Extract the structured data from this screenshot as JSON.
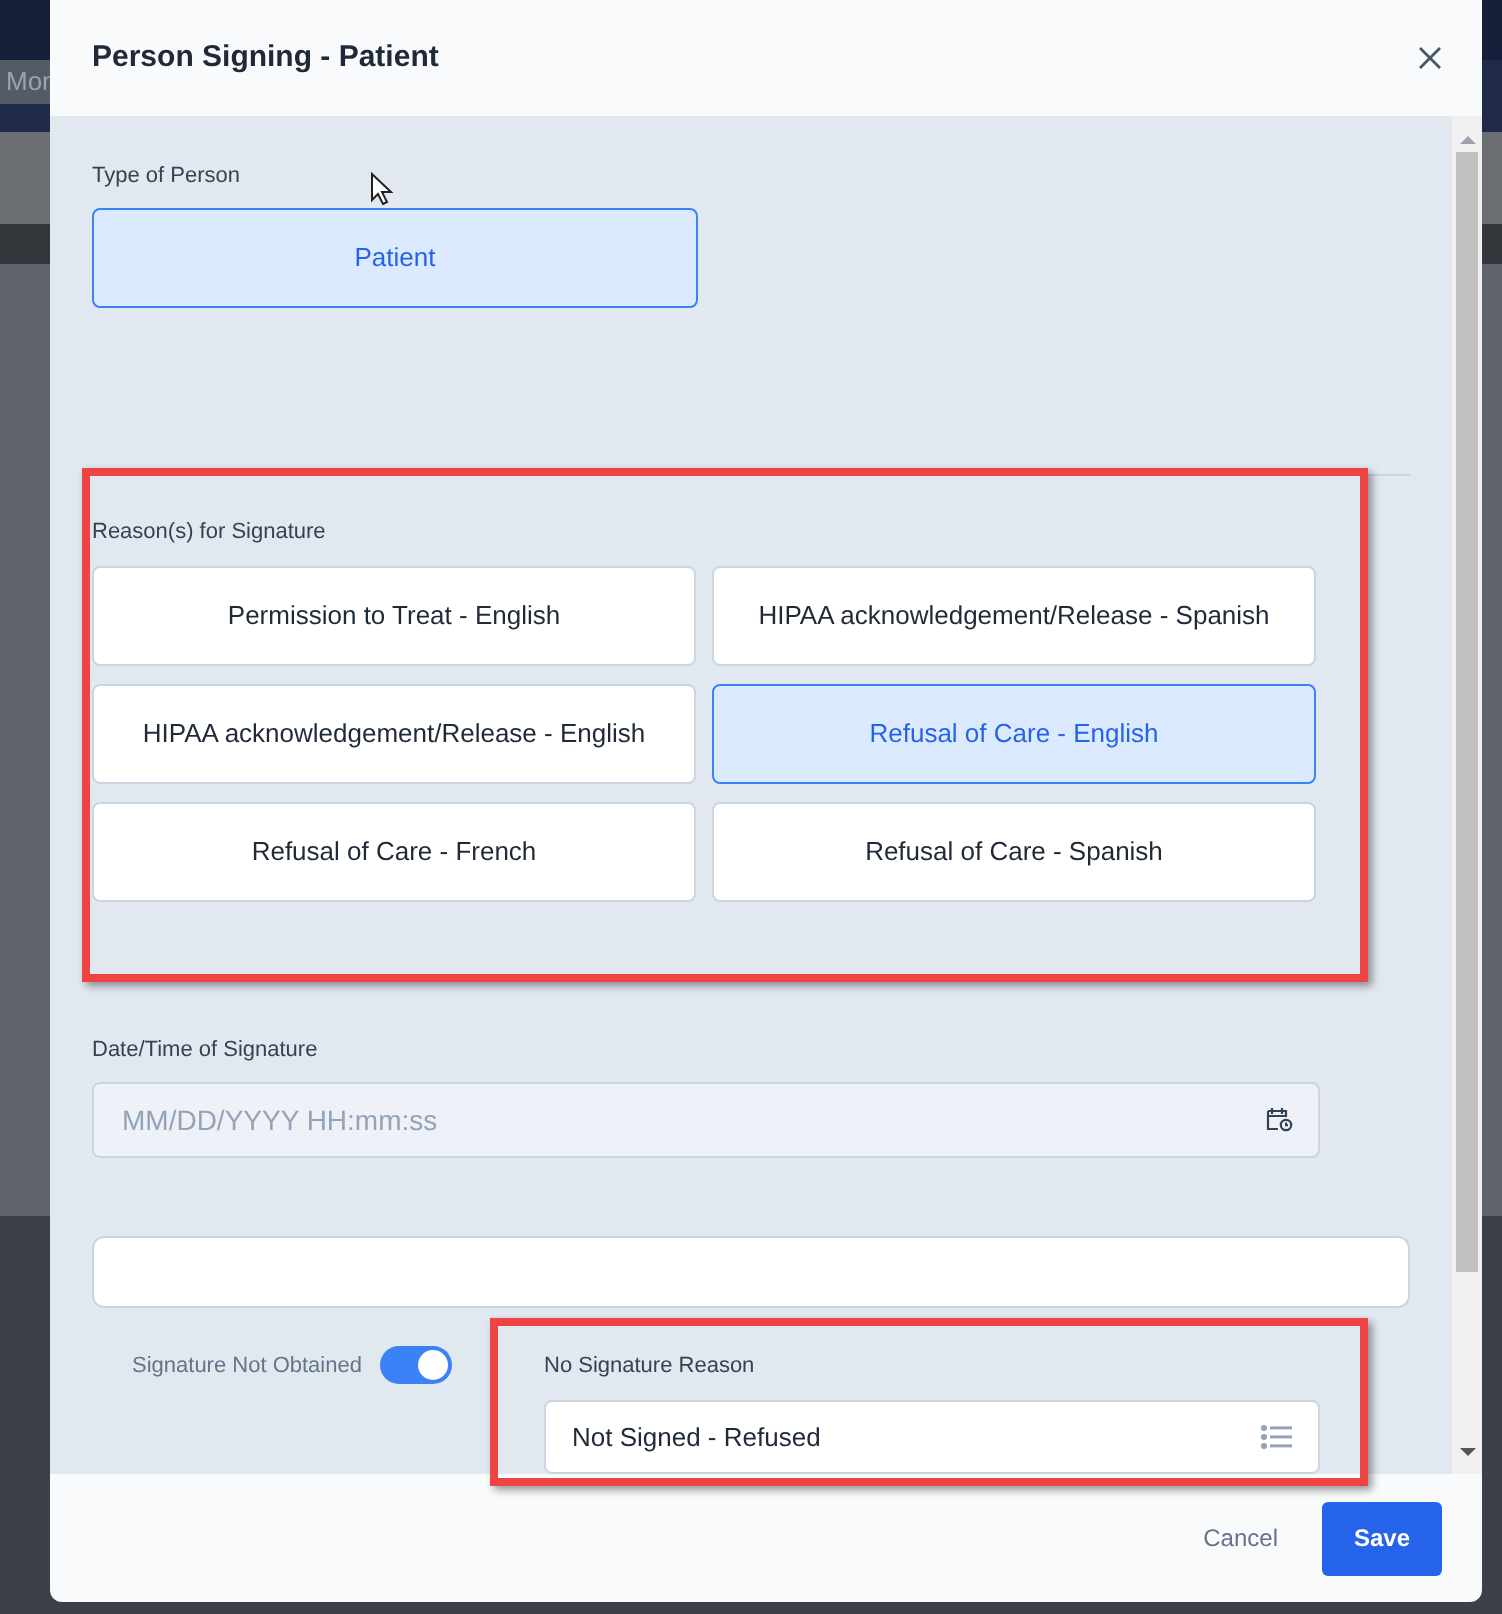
{
  "background": {
    "tab_label": "Mon"
  },
  "dialog": {
    "title": "Person Signing - Patient",
    "person_type": {
      "label": "Type of Person",
      "options": [
        {
          "label": "Patient",
          "selected": true
        }
      ]
    },
    "reasons": {
      "label": "Reason(s) for Signature",
      "options": [
        {
          "label": "Permission to Treat - English",
          "selected": false
        },
        {
          "label": "HIPAA acknowledgement/Release - Spanish",
          "selected": false
        },
        {
          "label": "HIPAA acknowledgement/Release - English",
          "selected": false
        },
        {
          "label": "Refusal of Care - English",
          "selected": true
        },
        {
          "label": "Refusal of Care - French",
          "selected": false
        },
        {
          "label": "Refusal of Care - Spanish",
          "selected": false
        }
      ]
    },
    "datetime": {
      "label": "Date/Time of Signature",
      "placeholder": "MM/DD/YYYY HH:mm:ss"
    },
    "signature_not_obtained": {
      "label": "Signature Not Obtained",
      "on": true
    },
    "no_signature_reason": {
      "label": "No Signature Reason",
      "value": "Not Signed - Refused"
    },
    "buttons": [
      {
        "label": "Cancel",
        "kind": "text"
      },
      {
        "label": "Save",
        "kind": "primary"
      }
    ]
  }
}
